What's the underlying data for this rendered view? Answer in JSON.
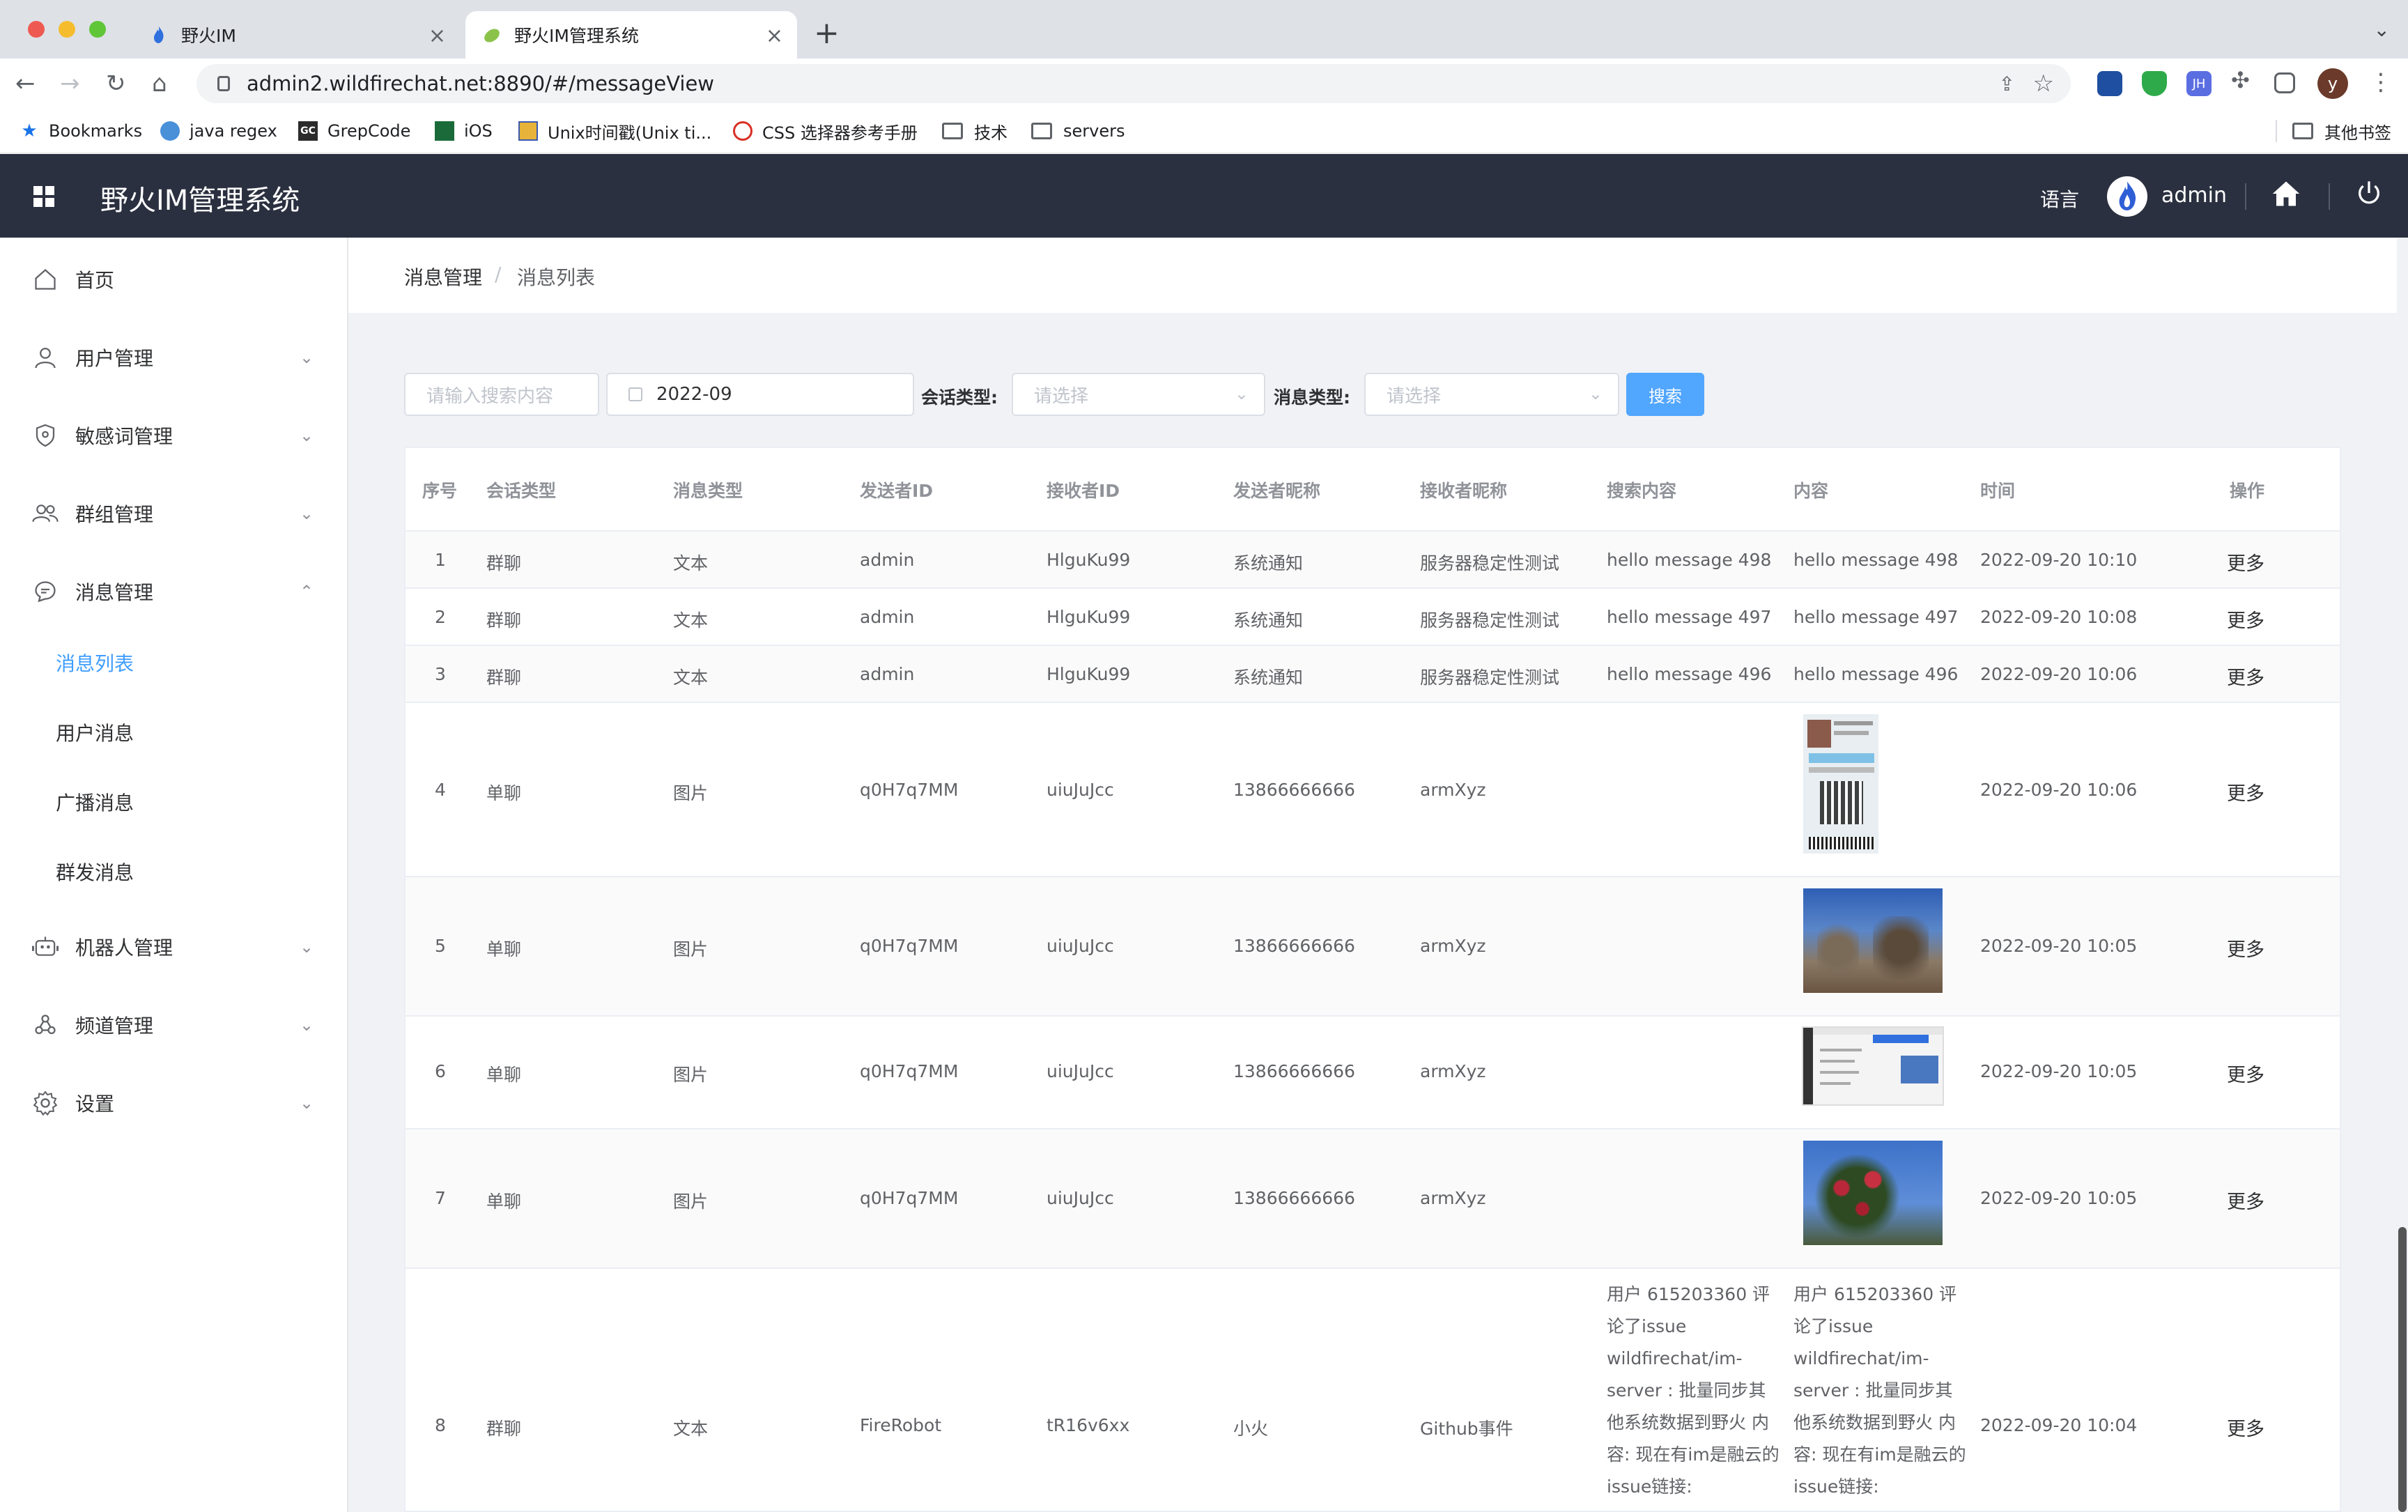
{
  "browser": {
    "tabs": [
      {
        "title": "野火IM"
      },
      {
        "title": "野火IM管理系统"
      }
    ],
    "url": "admin2.wildfirechat.net:8890/#/messageView",
    "bookmarks": [
      "Bookmarks",
      "java regex",
      "GrepCode",
      "iOS",
      "Unix时间戳(Unix ti...",
      "CSS 选择器参考手册",
      "技术",
      "servers"
    ],
    "other_bookmarks": "其他书签",
    "profile_initial": "y",
    "ext_jh": "JH",
    "gc_badge": "GC"
  },
  "header": {
    "title": "野火IM管理系统",
    "language": "语言",
    "username": "admin"
  },
  "sidebar": {
    "items": [
      {
        "label": "首页",
        "icon": "home-outline-icon"
      },
      {
        "label": "用户管理",
        "icon": "user-icon"
      },
      {
        "label": "敏感词管理",
        "icon": "shield-icon"
      },
      {
        "label": "群组管理",
        "icon": "group-icon"
      },
      {
        "label": "消息管理",
        "icon": "message-icon"
      },
      {
        "label": "机器人管理",
        "icon": "robot-icon"
      },
      {
        "label": "频道管理",
        "icon": "channel-icon"
      },
      {
        "label": "设置",
        "icon": "gear-icon"
      }
    ],
    "sub_items": [
      "消息列表",
      "用户消息",
      "广播消息",
      "群发消息"
    ]
  },
  "breadcrumb": {
    "parent": "消息管理",
    "separator": "/",
    "current": "消息列表"
  },
  "filters": {
    "search_placeholder": "请输入搜索内容",
    "date_value": "2022-09",
    "conv_type_label": "会话类型:",
    "conv_type_placeholder": "请选择",
    "msg_type_label": "消息类型:",
    "msg_type_placeholder": "请选择",
    "search_button": "搜索"
  },
  "table": {
    "columns": [
      "序号",
      "会话类型",
      "消息类型",
      "发送者ID",
      "接收者ID",
      "发送者昵称",
      "接收者昵称",
      "搜索内容",
      "内容",
      "时间",
      "操作"
    ],
    "more_label": "更多",
    "rows": [
      {
        "no": "1",
        "conv": "群聊",
        "type": "文本",
        "sender": "admin",
        "receiver": "HlguKu99",
        "sender_name": "系统通知",
        "receiver_name": "服务器稳定性测试",
        "search": "hello message 498",
        "content": "hello message 498",
        "time": "2022-09-20 10:10"
      },
      {
        "no": "2",
        "conv": "群聊",
        "type": "文本",
        "sender": "admin",
        "receiver": "HlguKu99",
        "sender_name": "系统通知",
        "receiver_name": "服务器稳定性测试",
        "search": "hello message 497",
        "content": "hello message 497",
        "time": "2022-09-20 10:08"
      },
      {
        "no": "3",
        "conv": "群聊",
        "type": "文本",
        "sender": "admin",
        "receiver": "HlguKu99",
        "sender_name": "系统通知",
        "receiver_name": "服务器稳定性测试",
        "search": "hello message 496",
        "content": "hello message 496",
        "time": "2022-09-20 10:06"
      },
      {
        "no": "4",
        "conv": "单聊",
        "type": "图片",
        "sender": "q0H7q7MM",
        "receiver": "uiuJuJcc",
        "sender_name": "13866666666",
        "receiver_name": "armXyz",
        "search": "",
        "content": "",
        "time": "2022-09-20 10:06"
      },
      {
        "no": "5",
        "conv": "单聊",
        "type": "图片",
        "sender": "q0H7q7MM",
        "receiver": "uiuJuJcc",
        "sender_name": "13866666666",
        "receiver_name": "armXyz",
        "search": "",
        "content": "",
        "time": "2022-09-20 10:05"
      },
      {
        "no": "6",
        "conv": "单聊",
        "type": "图片",
        "sender": "q0H7q7MM",
        "receiver": "uiuJuJcc",
        "sender_name": "13866666666",
        "receiver_name": "armXyz",
        "search": "",
        "content": "",
        "time": "2022-09-20 10:05"
      },
      {
        "no": "7",
        "conv": "单聊",
        "type": "图片",
        "sender": "q0H7q7MM",
        "receiver": "uiuJuJcc",
        "sender_name": "13866666666",
        "receiver_name": "armXyz",
        "search": "",
        "content": "",
        "time": "2022-09-20 10:05"
      },
      {
        "no": "8",
        "conv": "群聊",
        "type": "文本",
        "sender": "FireRobot",
        "receiver": "tR16v6xx",
        "sender_name": "小火",
        "receiver_name": "Github事件",
        "search": "用户 615203360 评论了issue wildfirechat/im-server : 批量同步其他系统数据到野火 内容: 现在有im是融云的 issue链接: https://github.com/",
        "content": "用户 615203360 评论了issue wildfirechat/im-server : 批量同步其他系统数据到野火 内容: 现在有im是融云的 issue链接: https://github.com/",
        "time": "2022-09-20 10:04"
      }
    ]
  }
}
